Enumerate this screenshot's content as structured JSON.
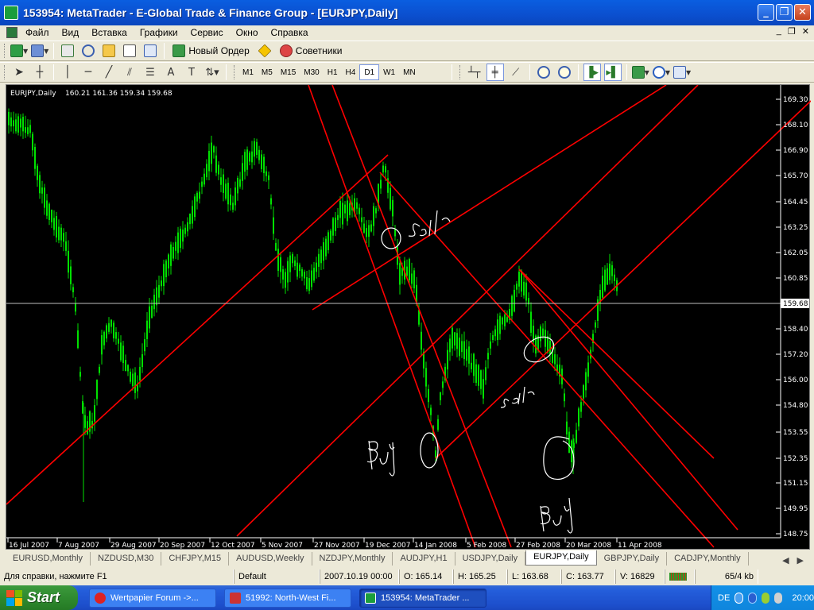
{
  "window": {
    "title": "153954: MetaTrader - E-Global Trade & Finance Group - [EURJPY,Daily]"
  },
  "menu": [
    "Файл",
    "Вид",
    "Вставка",
    "Графики",
    "Сервис",
    "Окно",
    "Справка"
  ],
  "toolbar1": {
    "new_order": "Новый Ордер",
    "advisors": "Советники"
  },
  "timeframes": [
    "M1",
    "M5",
    "M15",
    "M30",
    "H1",
    "H4",
    "D1",
    "W1",
    "MN"
  ],
  "active_timeframe": "D1",
  "chart": {
    "header": "EURJPY,Daily",
    "ohlc": "160.21 161.36 159.34 159.68",
    "current_price": "159.68",
    "price_labels": [
      "169.30",
      "168.10",
      "166.90",
      "165.70",
      "164.45",
      "163.25",
      "162.05",
      "160.85",
      "158.40",
      "157.20",
      "156.00",
      "154.80",
      "153.55",
      "152.35",
      "151.15",
      "149.95",
      "148.75"
    ],
    "date_labels": [
      "16 Jul 2007",
      "7 Aug 2007",
      "29 Aug 2007",
      "20 Sep 2007",
      "12 Oct 2007",
      "5 Nov 2007",
      "27 Nov 2007",
      "19 Dec 2007",
      "14 Jan 2008",
      "5 Feb 2008",
      "27 Feb 2008",
      "20 Mar 2008",
      "11 Apr 2008"
    ],
    "colors": {
      "background": "#000000",
      "candles": "#00e000",
      "lines": "#ff0000",
      "annotation": "#ffffff",
      "text": "#ffffff"
    }
  },
  "tabs": [
    "EURUSD,Monthly",
    "NZDUSD,M30",
    "CHFJPY,M15",
    "AUDUSD,Weekly",
    "NZDJPY,Monthly",
    "AUDJPY,H1",
    "USDJPY,Daily",
    "EURJPY,Daily",
    "GBPJPY,Daily",
    "CADJPY,Monthly"
  ],
  "active_tab": "EURJPY,Daily",
  "status": {
    "help": "Для справки, нажмите F1",
    "profile": "Default",
    "datetime": "2007.10.19 00:00",
    "open": "O: 165.14",
    "high": "H: 165.25",
    "low": "L: 163.68",
    "close": "C: 163.77",
    "volume": "V: 16829",
    "traffic": "65/4 kb"
  },
  "taskbar": {
    "start": "Start",
    "tasks": [
      "Wertpapier Forum ->...",
      "51992: North-West Fi...",
      "153954: MetaTrader ..."
    ],
    "lang": "DE",
    "clock": "20:00"
  }
}
